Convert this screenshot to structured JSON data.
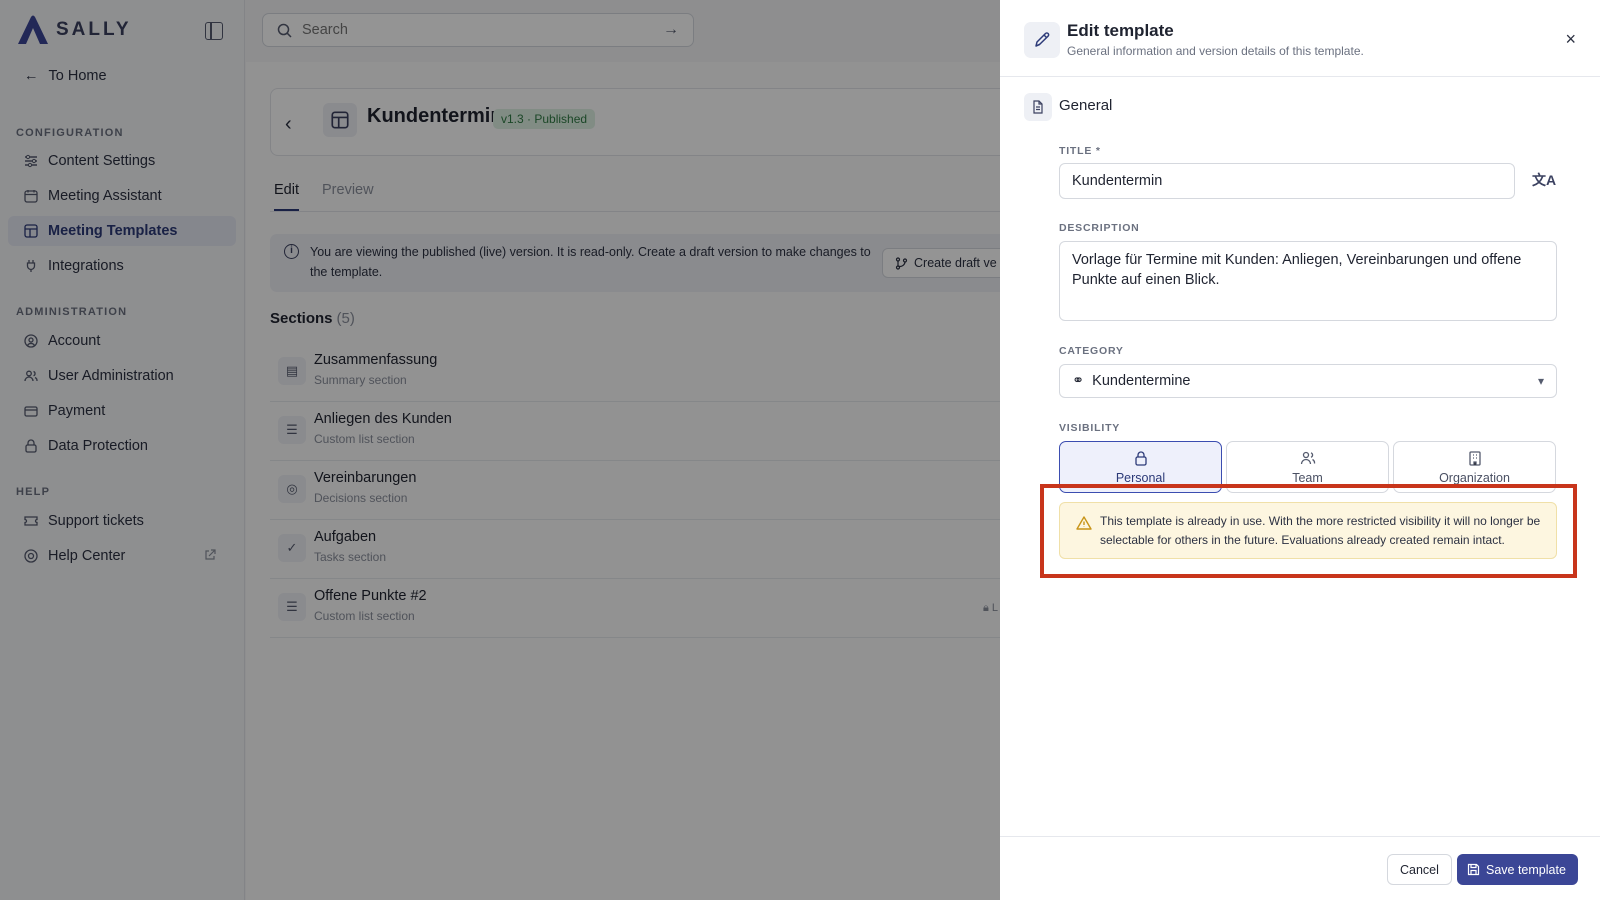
{
  "app": {
    "brand": "SALLY"
  },
  "sidebar": {
    "to_home": "To Home",
    "groups": [
      {
        "title": "CONFIGURATION",
        "items": [
          {
            "label": "Content Settings",
            "icon": "sliders-icon"
          },
          {
            "label": "Meeting Assistant",
            "icon": "calendar-icon"
          },
          {
            "label": "Meeting Templates",
            "icon": "template-icon",
            "active": true
          },
          {
            "label": "Integrations",
            "icon": "plug-icon"
          }
        ]
      },
      {
        "title": "ADMINISTRATION",
        "items": [
          {
            "label": "Account",
            "icon": "user-circle-icon"
          },
          {
            "label": "User Administration",
            "icon": "users-icon"
          },
          {
            "label": "Payment",
            "icon": "credit-card-icon"
          },
          {
            "label": "Data Protection",
            "icon": "lock-icon"
          }
        ]
      },
      {
        "title": "HELP",
        "items": [
          {
            "label": "Support tickets",
            "icon": "ticket-icon"
          },
          {
            "label": "Help Center",
            "icon": "lifebuoy-icon",
            "external": true
          }
        ]
      }
    ]
  },
  "search": {
    "placeholder": "Search"
  },
  "template": {
    "title": "Kundentermin",
    "version_badge": "v1.3 · Published",
    "tabs": [
      {
        "label": "Edit",
        "active": true
      },
      {
        "label": "Preview"
      }
    ],
    "info": "You are viewing the published (live) version. It is read-only. Create a draft version to make changes to the template.",
    "draft_button": "Create draft ve",
    "sections_label": "Sections",
    "sections_count": "(5)",
    "sections": [
      {
        "name": "Zusammenfassung",
        "type": "Summary section",
        "icon": "document-icon"
      },
      {
        "name": "Anliegen des Kunden",
        "type": "Custom list section",
        "icon": "list-icon"
      },
      {
        "name": "Vereinbarungen",
        "type": "Decisions section",
        "icon": "compass-icon"
      },
      {
        "name": "Aufgaben",
        "type": "Tasks section",
        "icon": "check-circle-icon"
      },
      {
        "name": "Offene Punkte #2",
        "type": "Custom list section",
        "icon": "list-icon",
        "locked_label": "L"
      }
    ]
  },
  "drawer": {
    "title": "Edit template",
    "subtitle": "General information and version details of this template.",
    "general": "General",
    "title_label": "TITLE *",
    "title_value": "Kundentermin",
    "description_label": "DESCRIPTION",
    "description_value": "Vorlage für Termine mit Kunden: Anliegen, Vereinbarungen und offene Punkte auf einen Blick.",
    "category_label": "CATEGORY",
    "category_value": "Kundentermine",
    "visibility_label": "VISIBILITY",
    "visibility_options": [
      {
        "label": "Personal",
        "icon": "lock-icon",
        "selected": true
      },
      {
        "label": "Team",
        "icon": "users-icon"
      },
      {
        "label": "Organization",
        "icon": "building-icon"
      }
    ],
    "warning": "This template is already in use. With the more restricted visibility it will no longer be selectable for others in the future. Evaluations already created remain intact.",
    "cancel": "Cancel",
    "save": "Save template"
  },
  "colors": {
    "primary": "#3b4696",
    "highlight": "#c8351b",
    "warning_bg": "#fdf6e0",
    "badge_bg": "#dff1e4"
  }
}
